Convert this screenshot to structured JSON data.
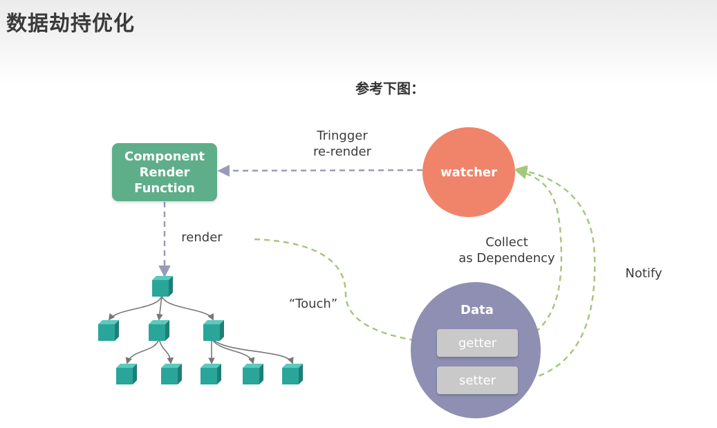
{
  "header": {
    "title": "数据劫持优化"
  },
  "subtitle": "参考下图：",
  "diagram": {
    "component_box": "Component\nRender\nFunction",
    "watcher": "watcher",
    "data": {
      "title": "Data",
      "getter": "getter",
      "setter": "setter"
    },
    "labels": {
      "trigger": "Tringger\nre-render",
      "render": "render",
      "touch": "“Touch”",
      "collect": "Collect\nas Dependency",
      "notify": "Notify"
    }
  },
  "colors": {
    "component": "#5fae8a",
    "watcher": "#f0846a",
    "data": "#8e8fb2",
    "pill": "#c9c9c9",
    "cube": "#2aa59a",
    "green_dash": "#a4c77e",
    "purple_dash": "#9a9ab8"
  }
}
